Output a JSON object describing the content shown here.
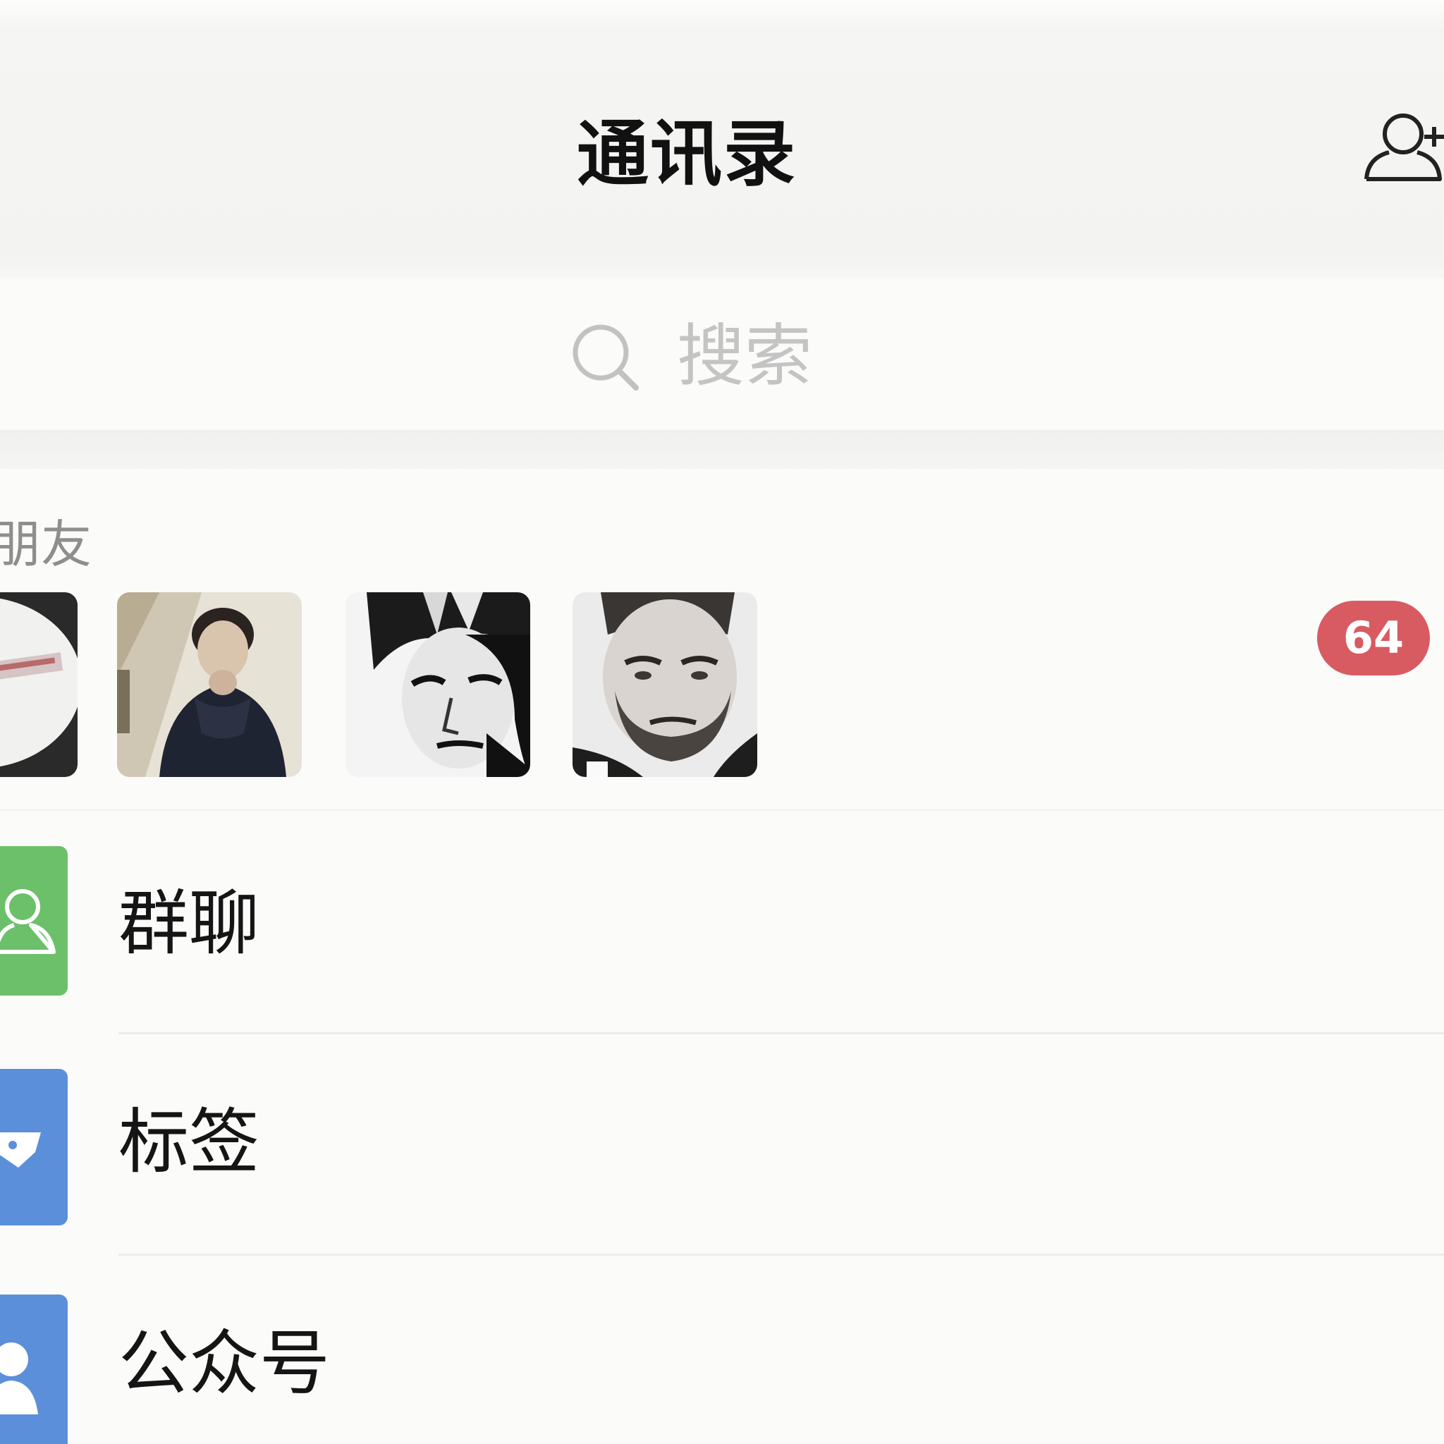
{
  "header": {
    "title": "通讯录",
    "add_friend_icon": "add-user-icon"
  },
  "search": {
    "placeholder": "搜索",
    "icon": "search-icon"
  },
  "friends_section": {
    "label": "朋友",
    "count_badge": "64"
  },
  "menu": {
    "items": [
      {
        "label": "群聊",
        "icon": "group-chat-icon",
        "color": "#6cc06a"
      },
      {
        "label": "标签",
        "icon": "tag-icon",
        "color": "#5b8fd9"
      },
      {
        "label": "公众号",
        "icon": "official-account-icon",
        "color": "#5b8fd9"
      }
    ]
  },
  "colors": {
    "badge": "#d85b62",
    "group_chat": "#6cc06a",
    "tag": "#5b8fd9",
    "official_account": "#5b8fd9"
  }
}
